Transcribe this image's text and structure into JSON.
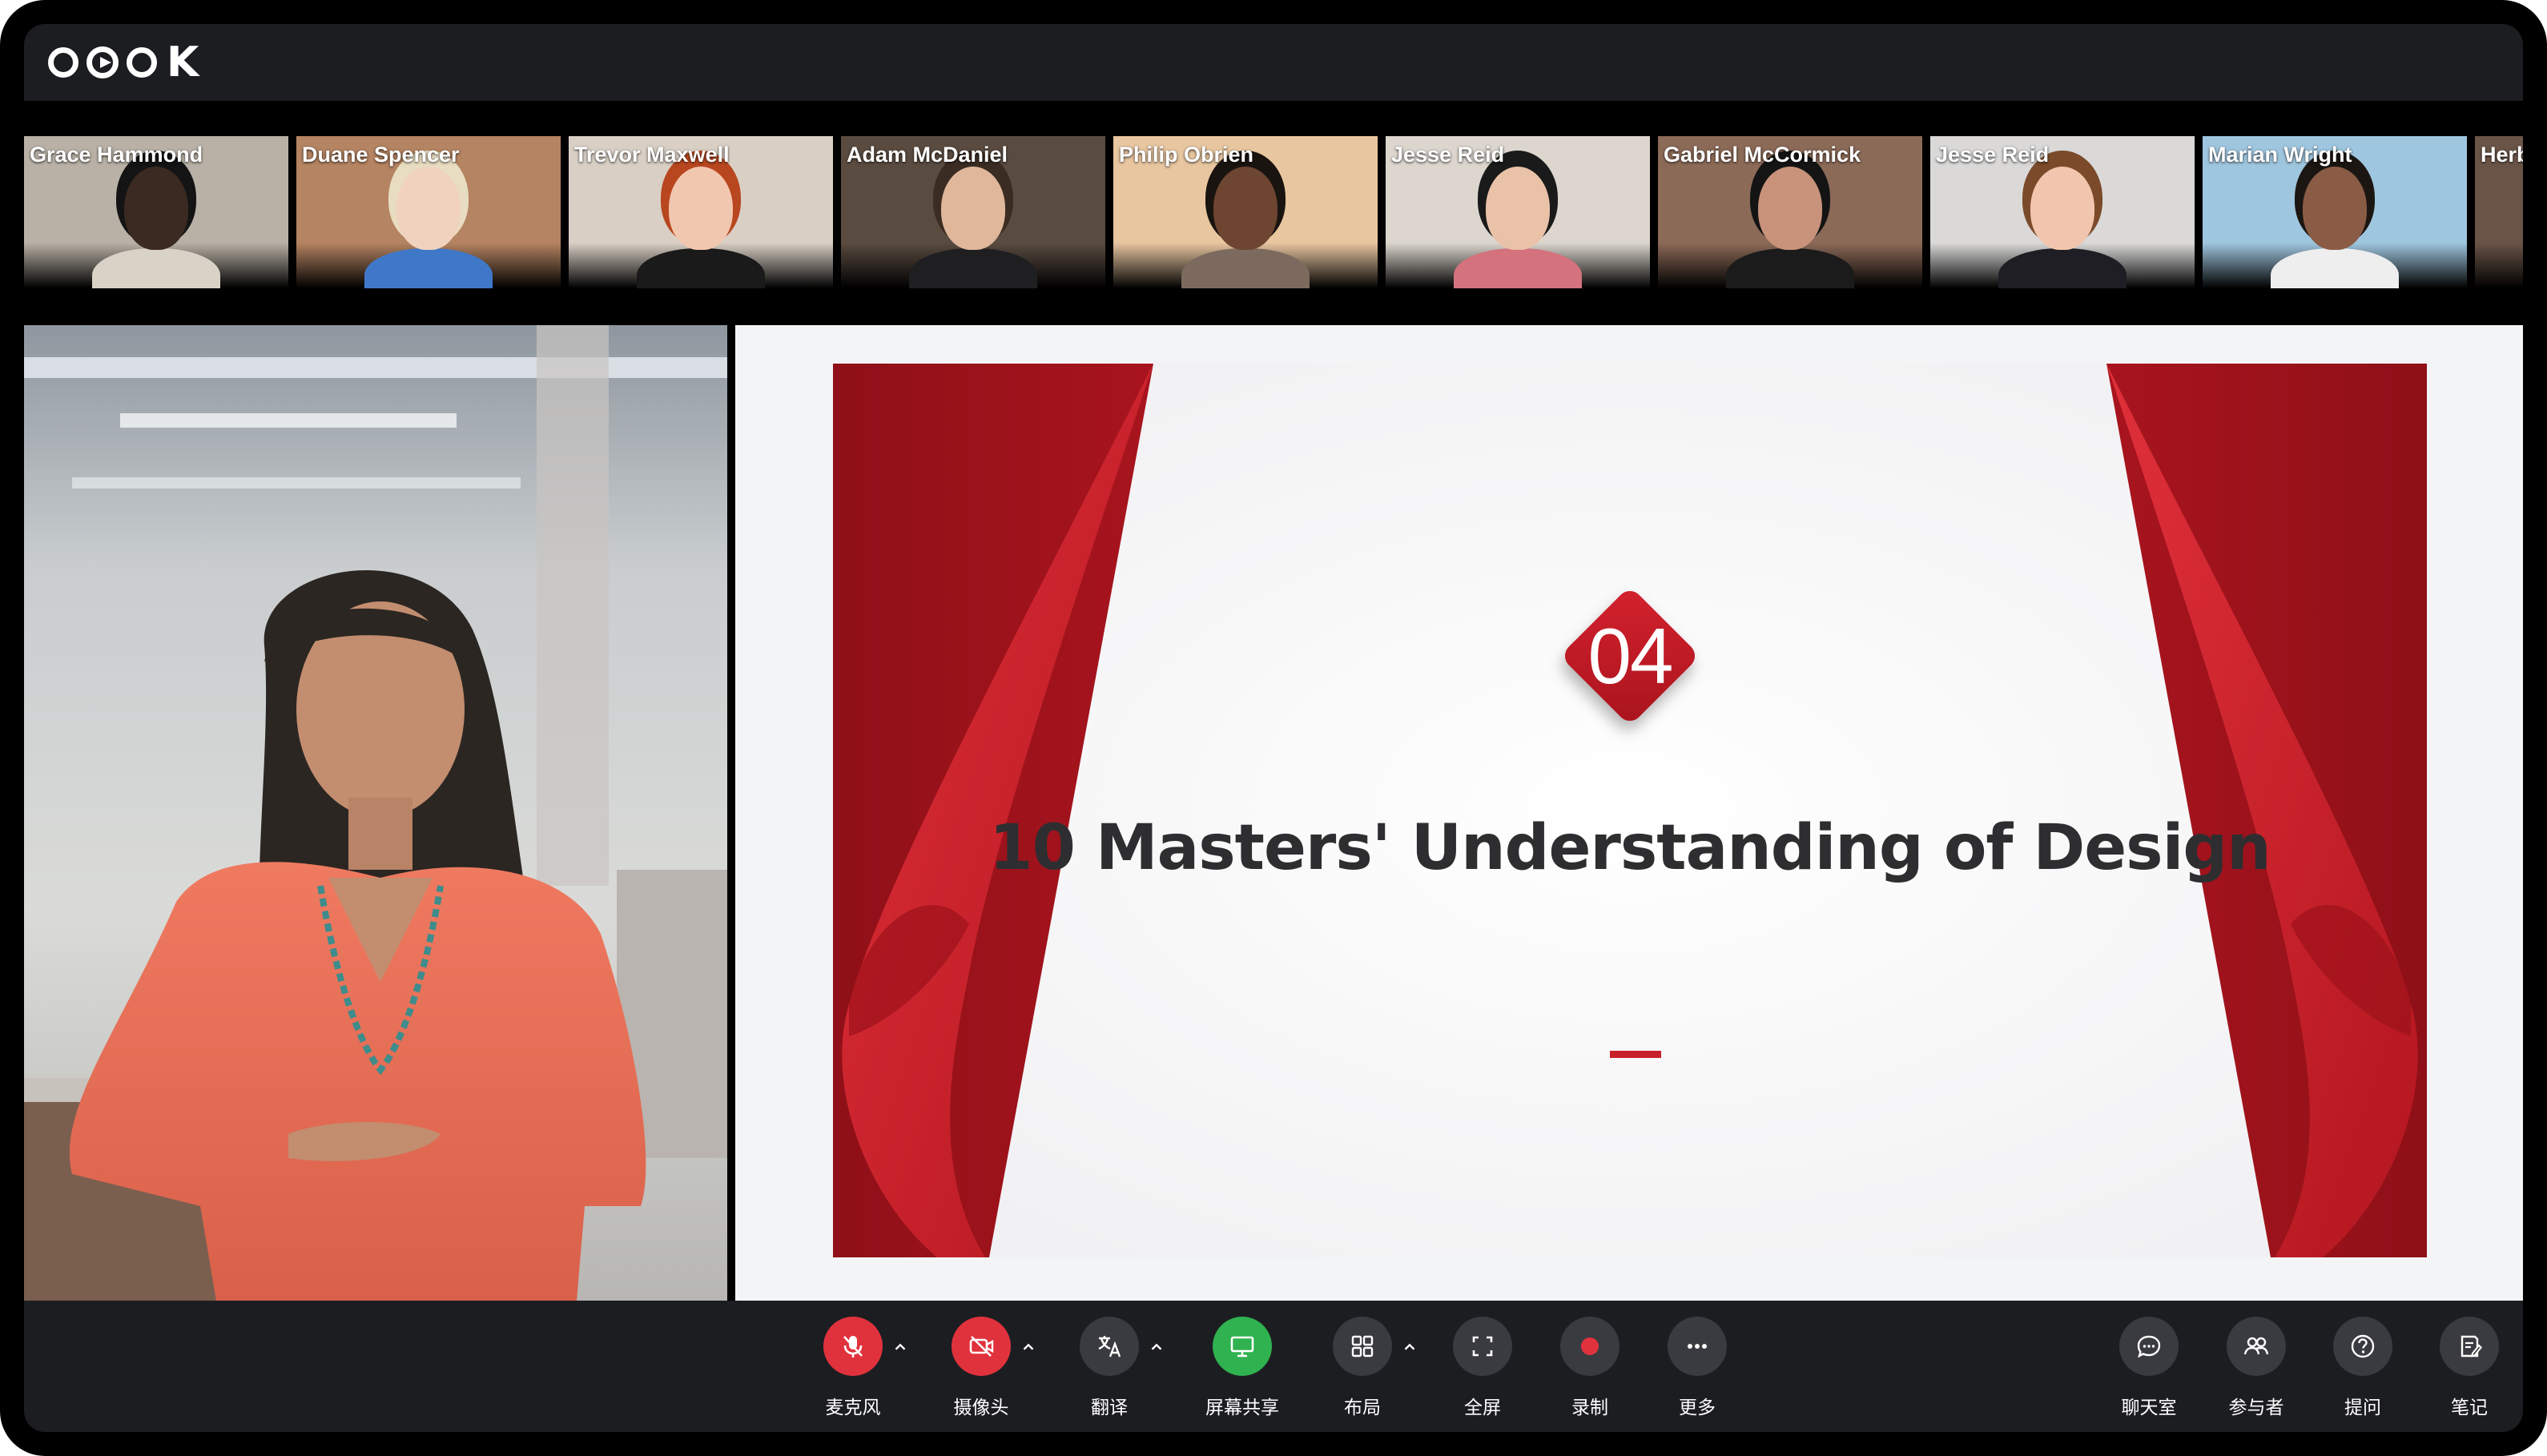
{
  "app": {
    "logo_text": "OOOK"
  },
  "participants": [
    {
      "name": "Grace Hammond",
      "bg": "#b9b1a6",
      "skin": "#3b2a21",
      "shirt": "#d9d2c6",
      "hair": "#141414"
    },
    {
      "name": "Duane Spencer",
      "bg": "#b58462",
      "skin": "#f1d2bf",
      "shirt": "#3f78c8",
      "hair": "#e8dcc1"
    },
    {
      "name": "Trevor Maxwell",
      "bg": "#d9cfc5",
      "skin": "#f2c7b0",
      "shirt": "#1a1a1a",
      "hair": "#b8471f"
    },
    {
      "name": "Adam McDaniel",
      "bg": "#5a4b40",
      "skin": "#e0b79b",
      "shirt": "#1f1f22",
      "hair": "#3a2c22"
    },
    {
      "name": "Philip Obrien",
      "bg": "#e8c6a0",
      "skin": "#6d4530",
      "shirt": "#7c6a5e",
      "hair": "#1a1410"
    },
    {
      "name": "Jesse Reid",
      "bg": "#dcd6ce",
      "skin": "#e9c2a8",
      "shirt": "#d4727d",
      "hair": "#1a1a1a"
    },
    {
      "name": "Gabriel McCormick",
      "bg": "#8c6a58",
      "skin": "#c8937a",
      "shirt": "#1b1b1b",
      "hair": "#141414"
    },
    {
      "name": "Jesse Reid",
      "bg": "#dad9d8",
      "skin": "#f2c6ae",
      "shirt": "#1e1e24",
      "hair": "#7a4a2a"
    },
    {
      "name": "Marian Wright",
      "bg": "#9fc6df",
      "skin": "#8a5c45",
      "shirt": "#eeeeee",
      "hair": "#1c1612"
    },
    {
      "name": "Herb",
      "bg": "#6a5448",
      "skin": "#cfa488",
      "shirt": "#333333",
      "hair": "#2a1d16"
    }
  ],
  "slide": {
    "number": "04",
    "title": "10 Masters' Understanding of Design",
    "accent": "#c8202a"
  },
  "controls": [
    {
      "id": "mic",
      "label": "麦克风",
      "icon": "mic-off-icon",
      "style": "red",
      "caret": true
    },
    {
      "id": "camera",
      "label": "摄像头",
      "icon": "camera-off-icon",
      "style": "red",
      "caret": true
    },
    {
      "id": "translate",
      "label": "翻译",
      "icon": "translate-icon",
      "style": "grey",
      "caret": true
    },
    {
      "id": "screen-share",
      "label": "屏幕共享",
      "icon": "screen-share-icon",
      "style": "green",
      "caret": false
    },
    {
      "id": "layout",
      "label": "布局",
      "icon": "layout-icon",
      "style": "grey",
      "caret": true
    },
    {
      "id": "fullscreen",
      "label": "全屏",
      "icon": "fullscreen-icon",
      "style": "grey",
      "caret": false
    },
    {
      "id": "record",
      "label": "录制",
      "icon": "record-icon",
      "style": "grey",
      "caret": false
    },
    {
      "id": "more",
      "label": "更多",
      "icon": "more-icon",
      "style": "grey",
      "caret": false
    }
  ],
  "right_controls": [
    {
      "id": "chat",
      "label": "聊天室",
      "icon": "chat-icon"
    },
    {
      "id": "participants",
      "label": "参与者",
      "icon": "participants-icon"
    },
    {
      "id": "questions",
      "label": "提问",
      "icon": "question-icon"
    },
    {
      "id": "notes",
      "label": "笔记",
      "icon": "notes-icon"
    }
  ],
  "colors": {
    "bar_bg": "#1c1d21",
    "button_grey": "#3a3b40",
    "button_red": "#e0323d",
    "button_green": "#2fb24f"
  }
}
